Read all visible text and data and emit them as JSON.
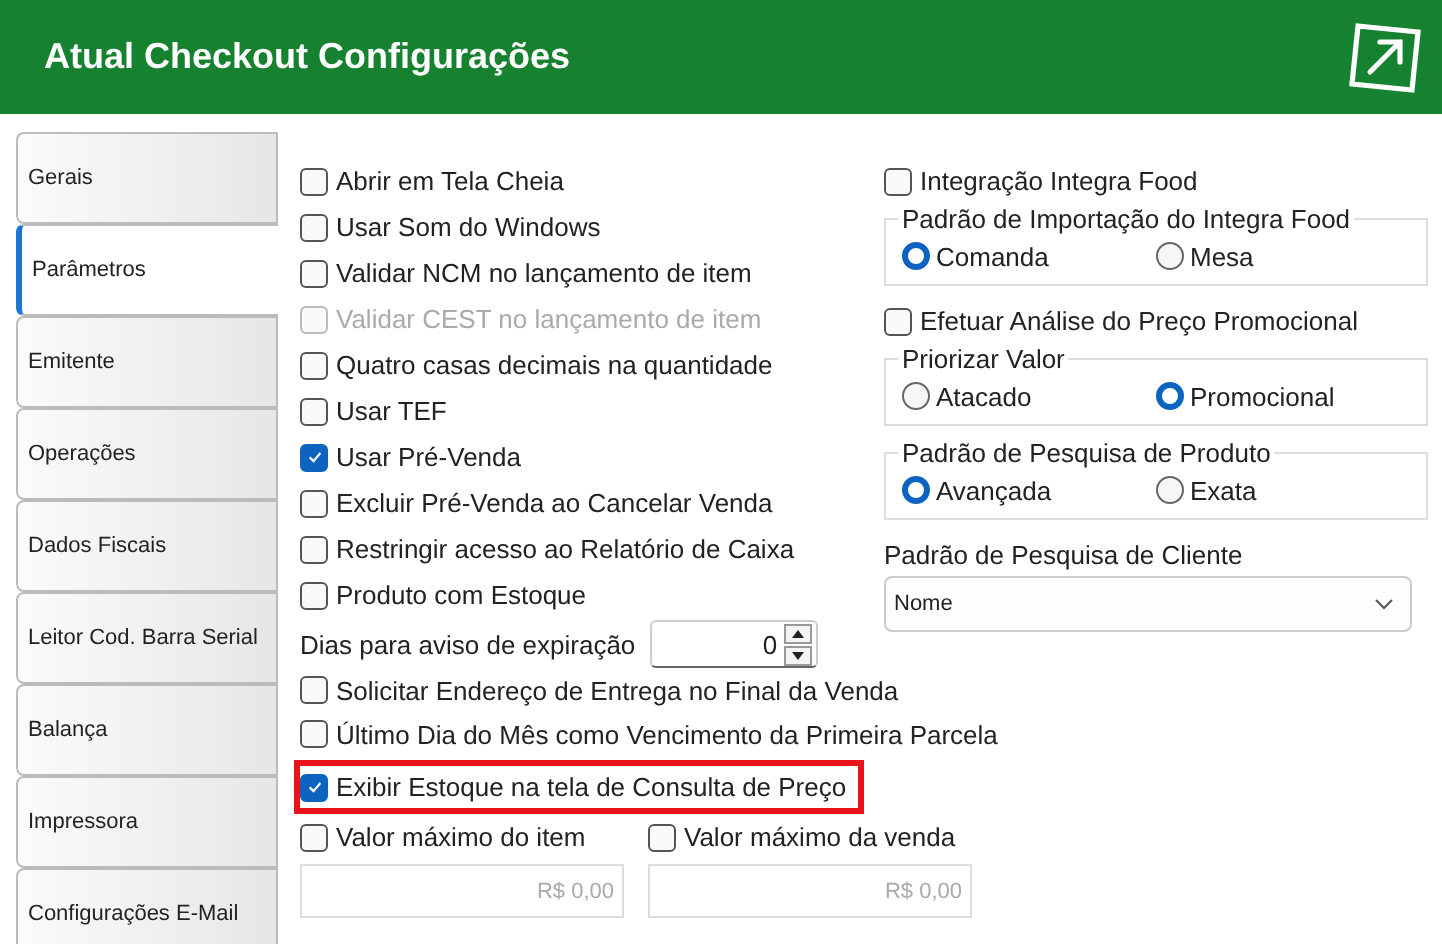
{
  "window": {
    "title": "Atual Checkout Configurações"
  },
  "tabs": [
    {
      "label": "Gerais",
      "selected": false
    },
    {
      "label": "Parâmetros",
      "selected": true
    },
    {
      "label": "Emitente",
      "selected": false
    },
    {
      "label": "Operações",
      "selected": false
    },
    {
      "label": "Dados Fiscais",
      "selected": false
    },
    {
      "label": "Leitor Cod. Barra Serial",
      "selected": false
    },
    {
      "label": "Balança",
      "selected": false
    },
    {
      "label": "Impressora",
      "selected": false
    },
    {
      "label": "Configurações E-Mail",
      "selected": false
    }
  ],
  "left_options": [
    {
      "label": "Abrir em Tela Cheia",
      "checked": false,
      "disabled": false
    },
    {
      "label": "Usar Som do Windows",
      "checked": false,
      "disabled": false
    },
    {
      "label": "Validar NCM no lançamento de item",
      "checked": false,
      "disabled": false
    },
    {
      "label": "Validar CEST no lançamento de item",
      "checked": false,
      "disabled": true
    },
    {
      "label": "Quatro casas decimais na quantidade",
      "checked": false,
      "disabled": false
    },
    {
      "label": "Usar TEF",
      "checked": false,
      "disabled": false
    },
    {
      "label": "Usar Pré-Venda",
      "checked": true,
      "disabled": false
    },
    {
      "label": "Excluir Pré-Venda ao Cancelar Venda",
      "checked": false,
      "disabled": false
    },
    {
      "label": "Restringir acesso ao Relatório de Caixa",
      "checked": false,
      "disabled": false
    },
    {
      "label": "Produto com Estoque",
      "checked": false,
      "disabled": false
    }
  ],
  "expiry": {
    "label": "Dias para aviso de expiração",
    "value": "0"
  },
  "right_sections": [
    {
      "kind": "checkbox",
      "label": "Integração Integra Food",
      "checked": false
    },
    {
      "kind": "radio",
      "title": "Padrão de Importação do Integra Food",
      "options": [
        {
          "label": "Comanda",
          "selected": true
        },
        {
          "label": "Mesa",
          "selected": false
        }
      ]
    },
    {
      "kind": "checkbox",
      "label": "Efetuar Análise do Preço Promocional",
      "checked": false
    },
    {
      "kind": "radio",
      "title": "Priorizar Valor",
      "options": [
        {
          "label": "Atacado",
          "selected": false
        },
        {
          "label": "Promocional",
          "selected": true
        }
      ]
    },
    {
      "kind": "radio",
      "title": "Padrão de Pesquisa de Produto",
      "options": [
        {
          "label": "Avançada",
          "selected": true
        },
        {
          "label": "Exata",
          "selected": false
        }
      ]
    }
  ],
  "client_search": {
    "label": "Padrão de Pesquisa de Cliente",
    "value": "Nome"
  },
  "bottom_options": [
    {
      "label": "Solicitar Endereço de Entrega no Final da Venda",
      "checked": false,
      "highlighted": false
    },
    {
      "label": "Último Dia do Mês como Vencimento da Primeira Parcela",
      "checked": false,
      "highlighted": false
    },
    {
      "label": "Exibir Estoque na tela de Consulta de Preço",
      "checked": true,
      "highlighted": true
    }
  ],
  "limits": [
    {
      "label": "Valor máximo do item",
      "checked": false,
      "value": "R$ 0,00",
      "disabled": true
    },
    {
      "label": "Valor máximo da venda",
      "checked": false,
      "value": "R$ 0,00",
      "disabled": true
    }
  ]
}
